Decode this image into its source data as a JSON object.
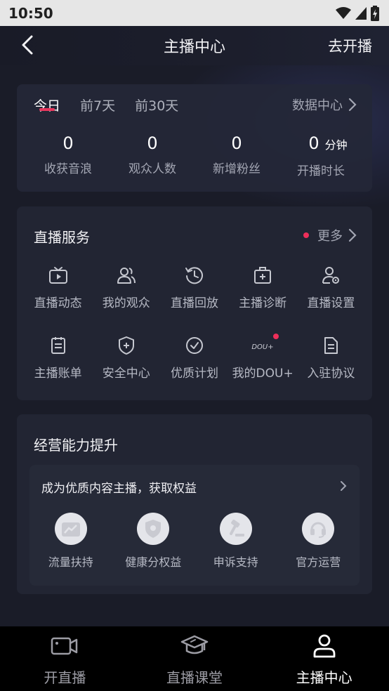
{
  "status_bar": {
    "time": "10:50"
  },
  "header": {
    "title": "主播中心",
    "action": "去开播"
  },
  "stats": {
    "tabs": [
      {
        "label": "今日",
        "active": true
      },
      {
        "label": "前7天",
        "active": false
      },
      {
        "label": "前30天",
        "active": false
      }
    ],
    "data_center": "数据中心",
    "items": [
      {
        "value": "0",
        "unit": "",
        "label": "收获音浪"
      },
      {
        "value": "0",
        "unit": "",
        "label": "观众人数"
      },
      {
        "value": "0",
        "unit": "",
        "label": "新增粉丝"
      },
      {
        "value": "0",
        "unit": "分钟",
        "label": "开播时长"
      }
    ]
  },
  "services": {
    "title": "直播服务",
    "more": "更多",
    "row1": [
      {
        "label": "直播动态",
        "icon": "tv-icon"
      },
      {
        "label": "我的观众",
        "icon": "audience-icon"
      },
      {
        "label": "直播回放",
        "icon": "replay-icon"
      },
      {
        "label": "主播诊断",
        "icon": "medical-kit-icon"
      },
      {
        "label": "直播设置",
        "icon": "user-settings-icon"
      }
    ],
    "row2": [
      {
        "label": "主播账单",
        "icon": "bill-icon"
      },
      {
        "label": "安全中心",
        "icon": "shield-icon"
      },
      {
        "label": "优质计划",
        "icon": "check-circle-icon"
      },
      {
        "label": "我的DOU+",
        "icon": "dou-plus-icon",
        "logo_text": "DOU+"
      },
      {
        "label": "入驻协议",
        "icon": "document-icon"
      }
    ]
  },
  "growth": {
    "title": "经营能力提升",
    "promo": "成为优质内容主播，获取权益",
    "benefits": [
      {
        "label": "流量扶持",
        "icon": "chart-icon"
      },
      {
        "label": "健康分权益",
        "icon": "shield-heart-icon"
      },
      {
        "label": "申诉支持",
        "icon": "gavel-icon"
      },
      {
        "label": "官方运营",
        "icon": "headset-icon"
      }
    ]
  },
  "bottom_nav": [
    {
      "label": "开直播",
      "icon": "camera-icon",
      "active": false
    },
    {
      "label": "直播课堂",
      "icon": "graduation-cap-icon",
      "active": false
    },
    {
      "label": "主播中心",
      "icon": "person-icon",
      "active": true
    }
  ],
  "colors": {
    "accent": "#ee2f5a",
    "background": "#1a1c28",
    "card": "#222533"
  }
}
